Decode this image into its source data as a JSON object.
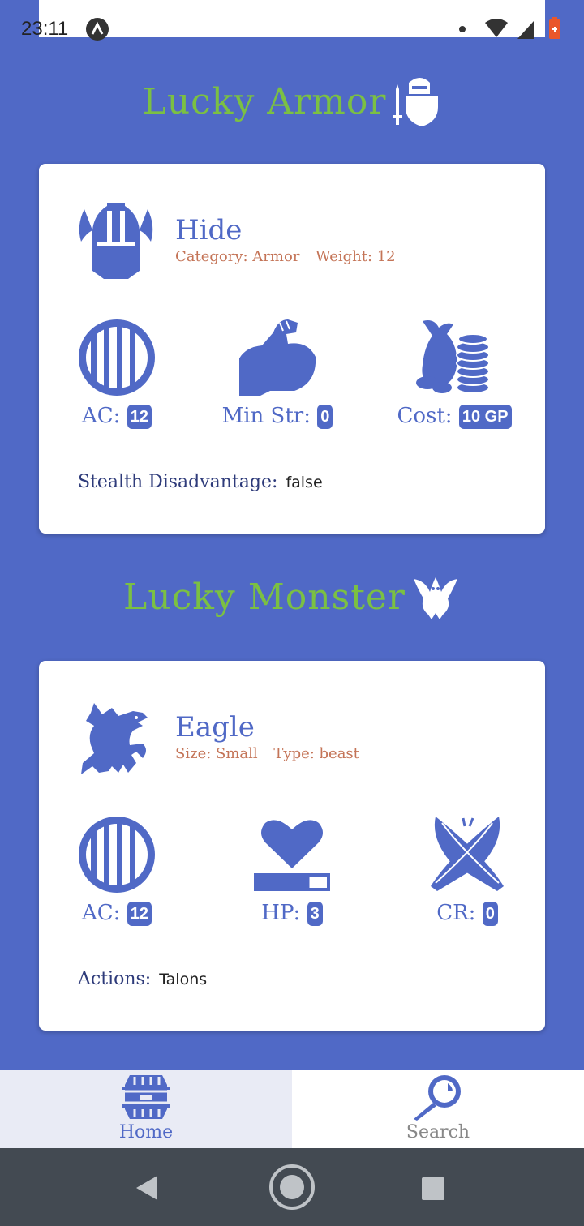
{
  "status": {
    "time": "23:11"
  },
  "armor_section": {
    "title": "Lucky Armor",
    "name": "Hide",
    "category": "Category: Armor",
    "weight": "Weight: 12",
    "ac_label": "AC:",
    "ac_value": "12",
    "str_label": "Min Str:",
    "str_value": "0",
    "cost_label": "Cost:",
    "cost_value": "10 GP",
    "stealth_label": "Stealth Disadvantage:",
    "stealth_value": "false"
  },
  "monster_section": {
    "title": "Lucky Monster",
    "name": "Eagle",
    "size": "Size: Small",
    "type": "Type: beast",
    "ac_label": "AC:",
    "ac_value": "12",
    "hp_label": "HP:",
    "hp_value": "3",
    "hp_fraction": 0.75,
    "cr_label": "CR:",
    "cr_value": "0",
    "actions_label": "Actions:",
    "actions_value": "Talons"
  },
  "nav": {
    "home": "Home",
    "search": "Search",
    "active": "Home"
  },
  "colors": {
    "primary": "#5069c6",
    "title_green": "#7bc043",
    "subtext": "#c47457"
  }
}
